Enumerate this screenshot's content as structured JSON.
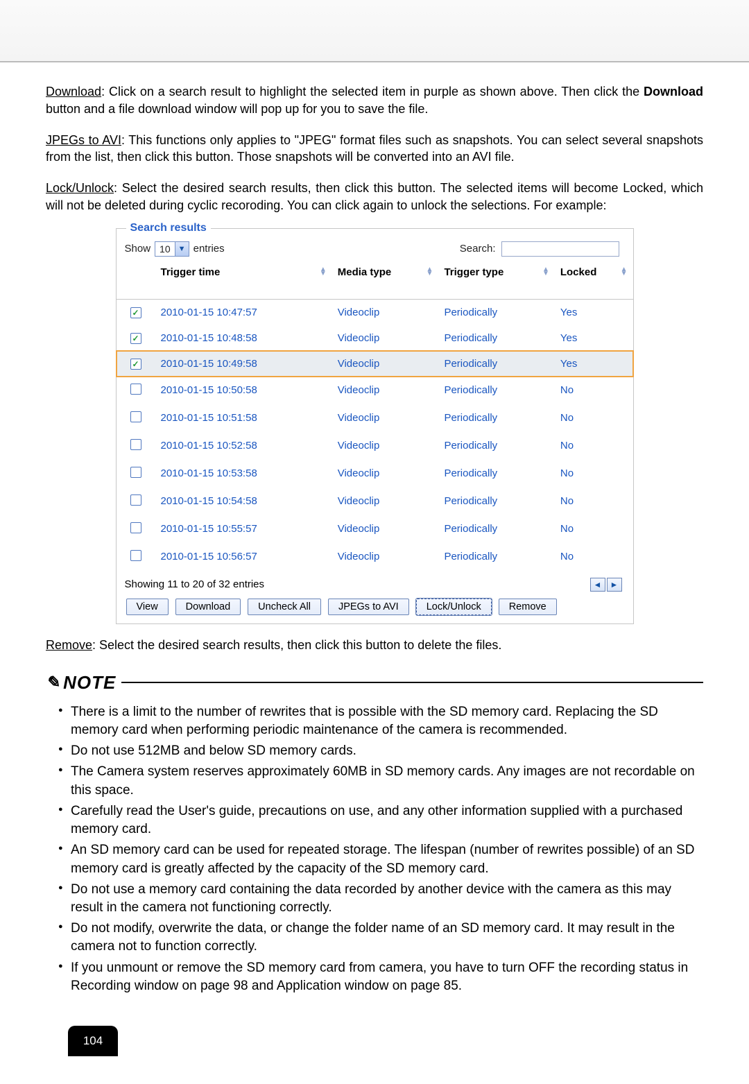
{
  "paragraphs": {
    "download_head": "Download",
    "download_body": ": Click on a search result to highlight the selected item in purple as shown above. Then click the ",
    "download_bold": "Download",
    "download_tail": " button and a file download window will pop up for you to save the file.",
    "jpegs_head": "JPEGs to AVI",
    "jpegs_body": ": This functions only applies to \"JPEG\" format files such as snapshots. You can select several snapshots from the list, then click this button. Those snapshots will be converted into an AVI file.",
    "lock_head": "Lock/Unlock",
    "lock_body": ": Select the desired search results, then click this button. The selected items will become Locked, which will not be deleted during cyclic recoroding. You can click again to unlock the selections. For example:",
    "remove_head": "Remove",
    "remove_body": ": Select the desired search results, then click this button to delete the files."
  },
  "search_results": {
    "legend": "Search results",
    "show_label": "Show",
    "show_value": "10",
    "entries_label": "entries",
    "search_label": "Search:",
    "headers": {
      "col2": "Trigger time",
      "col3": "Media type",
      "col4": "Trigger type",
      "col5": "Locked"
    },
    "rows": [
      {
        "checked": true,
        "highlight": false,
        "time": "2010-01-15 10:47:57",
        "media": "Videoclip",
        "trigger": "Periodically",
        "locked": "Yes"
      },
      {
        "checked": true,
        "highlight": false,
        "time": "2010-01-15 10:48:58",
        "media": "Videoclip",
        "trigger": "Periodically",
        "locked": "Yes"
      },
      {
        "checked": true,
        "highlight": true,
        "time": "2010-01-15 10:49:58",
        "media": "Videoclip",
        "trigger": "Periodically",
        "locked": "Yes"
      },
      {
        "checked": false,
        "highlight": false,
        "time": "2010-01-15 10:50:58",
        "media": "Videoclip",
        "trigger": "Periodically",
        "locked": "No"
      },
      {
        "checked": false,
        "highlight": false,
        "time": "2010-01-15 10:51:58",
        "media": "Videoclip",
        "trigger": "Periodically",
        "locked": "No"
      },
      {
        "checked": false,
        "highlight": false,
        "time": "2010-01-15 10:52:58",
        "media": "Videoclip",
        "trigger": "Periodically",
        "locked": "No"
      },
      {
        "checked": false,
        "highlight": false,
        "time": "2010-01-15 10:53:58",
        "media": "Videoclip",
        "trigger": "Periodically",
        "locked": "No"
      },
      {
        "checked": false,
        "highlight": false,
        "time": "2010-01-15 10:54:58",
        "media": "Videoclip",
        "trigger": "Periodically",
        "locked": "No"
      },
      {
        "checked": false,
        "highlight": false,
        "time": "2010-01-15 10:55:57",
        "media": "Videoclip",
        "trigger": "Periodically",
        "locked": "No"
      },
      {
        "checked": false,
        "highlight": false,
        "time": "2010-01-15 10:56:57",
        "media": "Videoclip",
        "trigger": "Periodically",
        "locked": "No"
      }
    ],
    "paging": "Showing 11 to 20 of 32 entries",
    "buttons": {
      "view": "View",
      "download": "Download",
      "uncheck": "Uncheck All",
      "jpegs": "JPEGs to AVI",
      "lock": "Lock/Unlock",
      "remove": "Remove"
    }
  },
  "note": {
    "heading": "NOTE",
    "items": [
      "There is a limit to the number of rewrites that is possible with the SD memory card. Replacing the SD memory card when performing periodic maintenance of the camera is recommended.",
      "Do not use 512MB and below SD memory cards.",
      "The Camera system reserves approximately 60MB in SD memory cards. Any images are not recordable on this space.",
      "Carefully read the User's guide, precautions on use, and any other information supplied with a purchased memory card.",
      "An SD memory card can be used for repeated storage. The lifespan (number of rewrites possible) of an SD memory card is greatly affected by the capacity of the SD memory card.",
      "Do not use a memory card containing the data recorded by another device with the camera as this may result in the camera not functioning correctly.",
      "Do not modify, overwrite the data, or change the folder name of an SD memory card. It may result in the camera not to function correctly.",
      "If you unmount or remove the SD memory card from camera, you have to turn OFF the recording status in Recording window on page 98 and Application window on page 85."
    ]
  },
  "page_number": "104"
}
